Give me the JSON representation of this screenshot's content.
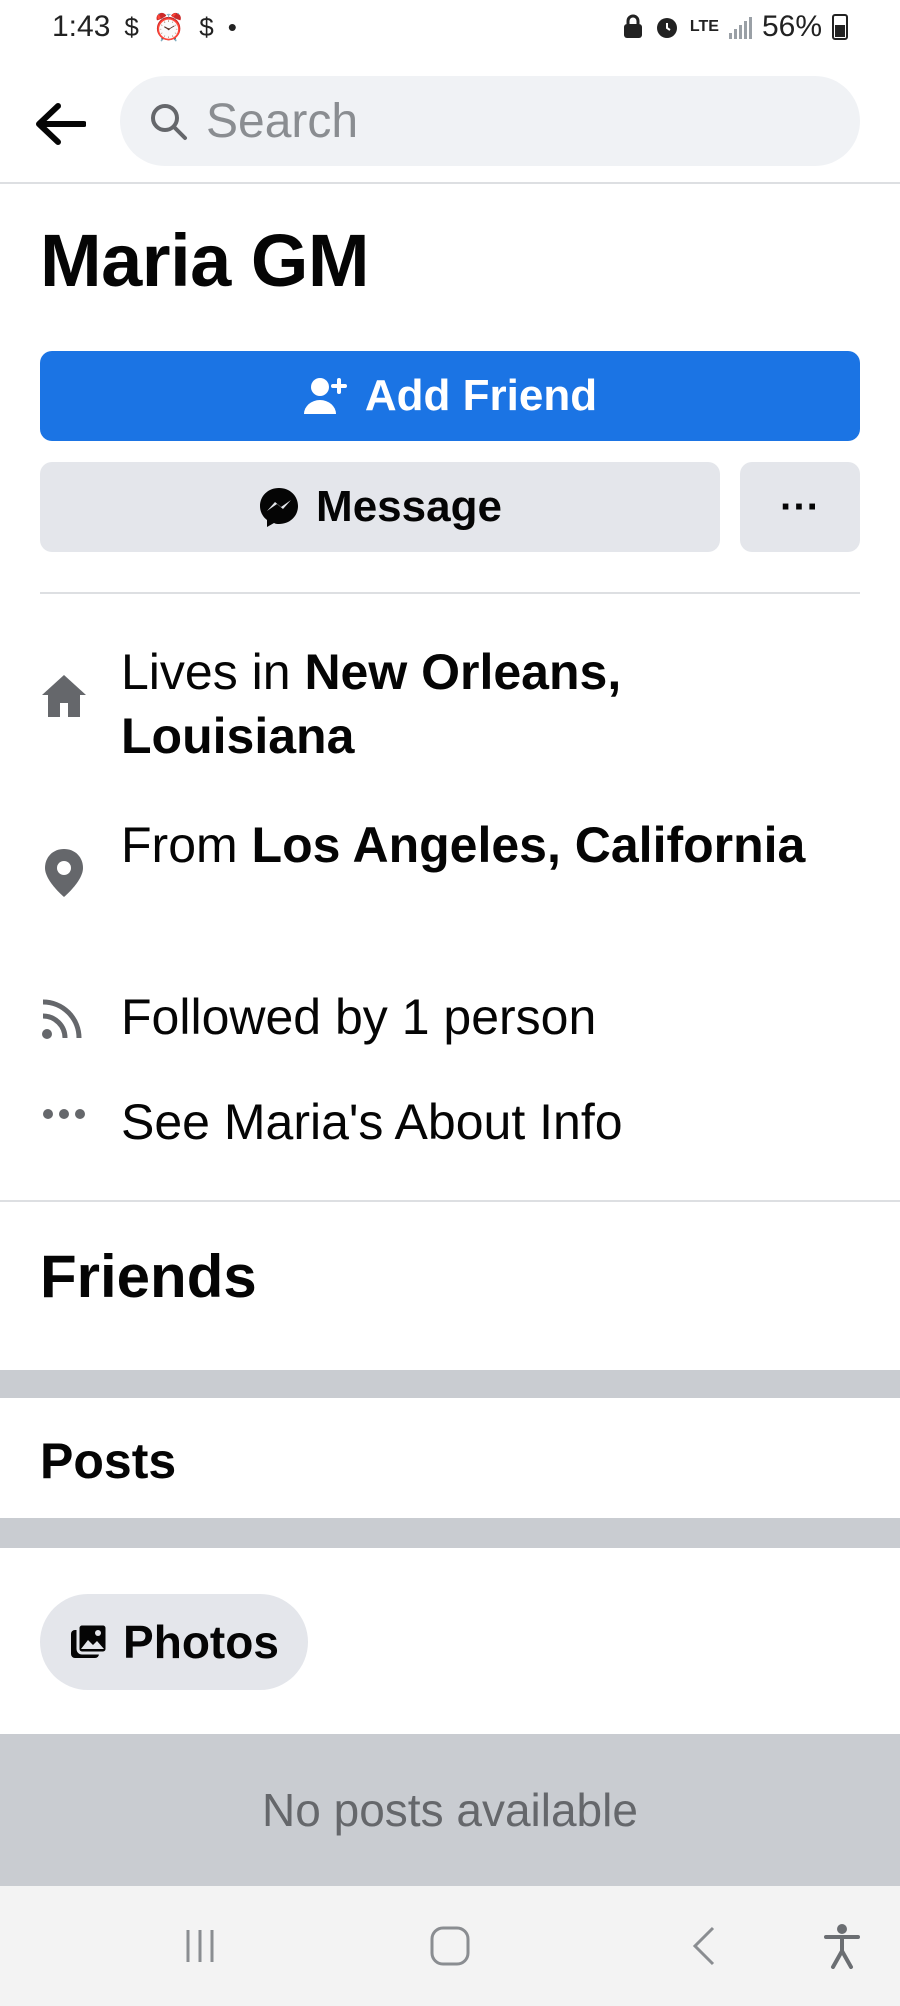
{
  "status_bar": {
    "time": "1:43",
    "left_glyphs": [
      "$",
      "⏰",
      "$",
      "•"
    ],
    "network": "LTE",
    "battery": "56%"
  },
  "search": {
    "placeholder": "Search"
  },
  "profile": {
    "name": "Maria GM",
    "add_friend_label": "Add Friend",
    "message_label": "Message",
    "more_label": "···"
  },
  "intro": {
    "lives_prefix": "Lives in ",
    "lives_place": "New Orleans, Louisiana",
    "from_prefix": "From ",
    "from_place": "Los Angeles, California",
    "followed": "Followed by 1 person",
    "about": "See Maria's About Info"
  },
  "sections": {
    "friends": "Friends",
    "posts": "Posts",
    "photos": "Photos",
    "empty_posts": "No posts available"
  },
  "colors": {
    "primary": "#1b74e4",
    "button_gray": "#e4e6eb",
    "band_gray": "#c9ccd1"
  },
  "icons": [
    "back-arrow-icon",
    "search-icon",
    "add-friend-icon",
    "messenger-icon",
    "home-icon",
    "location-pin-icon",
    "rss-icon",
    "more-dots-icon",
    "photos-icon",
    "recents-icon",
    "home-nav-icon",
    "back-nav-icon",
    "accessibility-icon"
  ]
}
